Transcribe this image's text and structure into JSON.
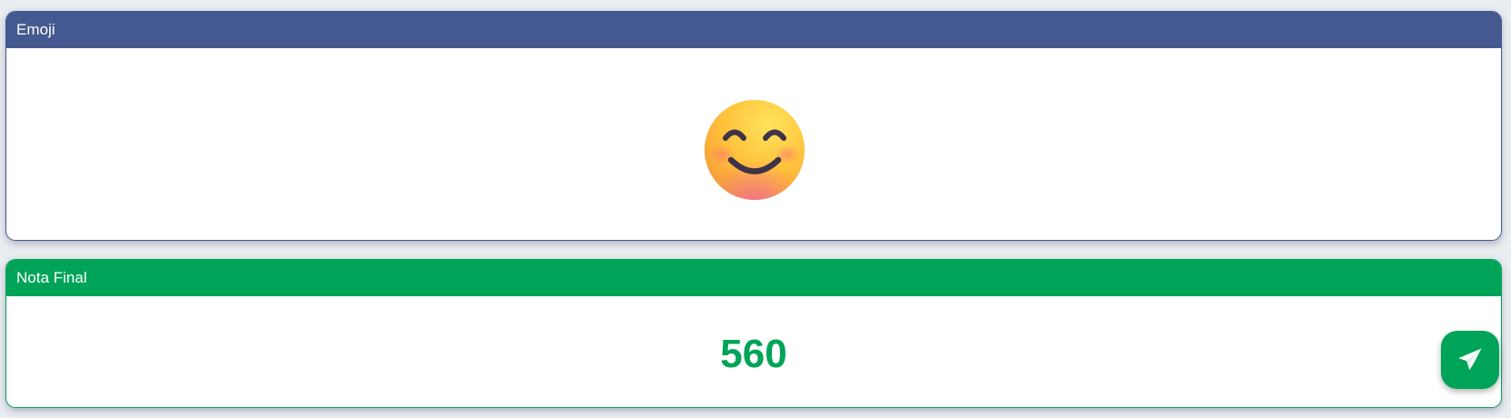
{
  "emoji_panel": {
    "title": "Emoji",
    "emoji_icon": "smiling-face-with-smiling-eyes-icon",
    "colors": {
      "header": "#44598f",
      "border": "#43598f"
    }
  },
  "grade_panel": {
    "title": "Nota Final",
    "value": "560",
    "colors": {
      "header": "#00a458",
      "value_text": "#00a458"
    }
  },
  "send_button": {
    "icon": "paper-plane-icon",
    "color": "#00a458"
  }
}
